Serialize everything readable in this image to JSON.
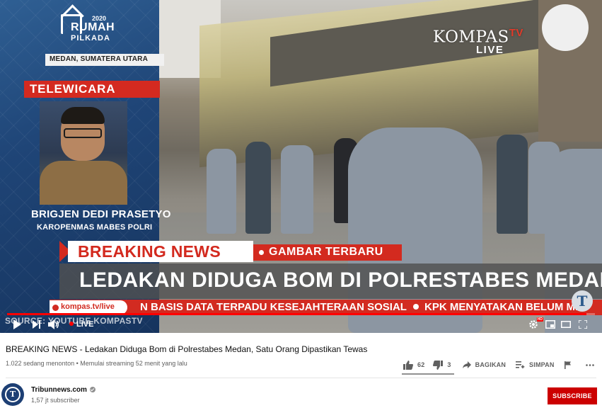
{
  "player": {
    "overlay": {
      "logo_year": "2020",
      "logo_line1": "RUMAH",
      "logo_line2": "PILKADA",
      "location": "MEDAN, SUMATERA UTARA",
      "segment": "TELEWICARA",
      "speaker_name": "BRIGJEN DEDI PRASETYO",
      "speaker_role": "KAROPENMAS MABES POLRI",
      "broadcaster": "KOMPAS",
      "broadcaster_suffix": "TV",
      "broadcaster_live": "LIVE",
      "breaking_label": "BREAKING NEWS",
      "tag": "GAMBAR TERBARU",
      "headline": "LEDAKAN DIDUGA BOM DI POLRESTABES MEDAN",
      "ticker_site": "kompas.tv/live",
      "ticker_1": "N BASIS DATA TERPADU KESEJAHTERAAN SOSIAL",
      "ticker_2": "KPK MENYATAKAN BELUM ME",
      "corner_logo": "T",
      "source": "SOURCE: YOUTUBE KOMPASTV"
    },
    "controls": {
      "live_label": "LIVE",
      "progress": 0.985,
      "hd": "HD"
    }
  },
  "video": {
    "title": "BREAKING NEWS - Ledakan Diduga Bom di Polrestabes Medan, Satu Orang Dipastikan Tewas",
    "meta": "1.022 sedang menonton • Memulai streaming 52 menit yang lalu",
    "likes": "62",
    "dislikes": "3",
    "share_label": "BAGIKAN",
    "save_label": "SIMPAN",
    "like_ratio": 0.95
  },
  "channel": {
    "name": "Tribunnews.com",
    "subscribers": "1,57 jt subscriber",
    "subscribe_label": "SUBSCRIBE",
    "avatar_letter": "T"
  }
}
